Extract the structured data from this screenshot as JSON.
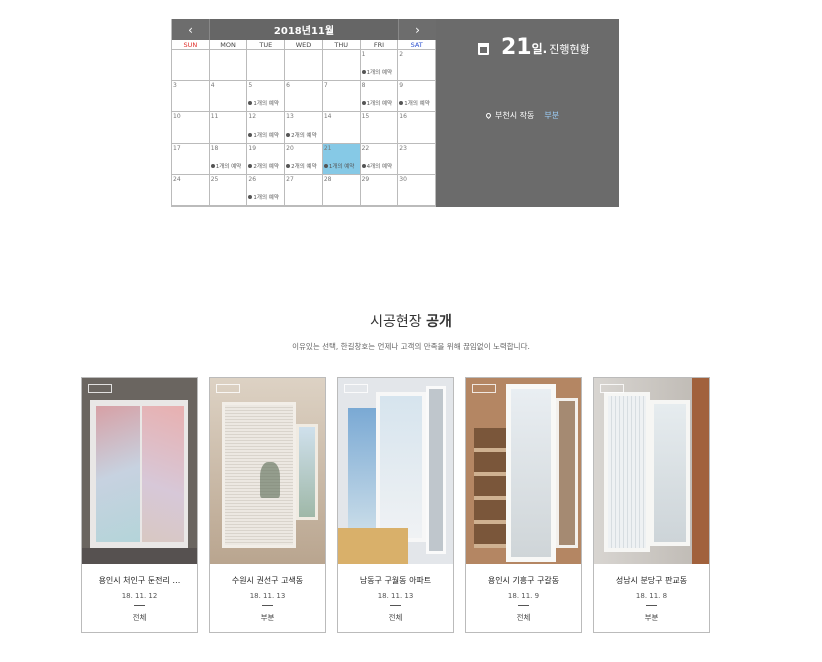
{
  "calendar": {
    "title": "2018년11월",
    "prev_label": "‹",
    "next_label": "›",
    "weekdays": [
      "SUN",
      "MON",
      "TUE",
      "WED",
      "THU",
      "FRI",
      "SAT"
    ],
    "weeks": [
      [
        {
          "d": "",
          "e": ""
        },
        {
          "d": "",
          "e": ""
        },
        {
          "d": "",
          "e": ""
        },
        {
          "d": "",
          "e": ""
        },
        {
          "d": "",
          "e": ""
        },
        {
          "d": "1",
          "e": "1개의 예약"
        },
        {
          "d": "2",
          "e": ""
        }
      ],
      [
        {
          "d": "3",
          "e": ""
        },
        {
          "d": "4",
          "e": ""
        },
        {
          "d": "5",
          "e": "1개의 예약"
        },
        {
          "d": "6",
          "e": ""
        },
        {
          "d": "7",
          "e": ""
        },
        {
          "d": "8",
          "e": "1개의 예약"
        },
        {
          "d": "9",
          "e": "1개의 예약"
        }
      ],
      [
        {
          "d": "10",
          "e": ""
        },
        {
          "d": "11",
          "e": ""
        },
        {
          "d": "12",
          "e": "1개의 예약"
        },
        {
          "d": "13",
          "e": "2개의 예약"
        },
        {
          "d": "14",
          "e": ""
        },
        {
          "d": "15",
          "e": ""
        },
        {
          "d": "16",
          "e": ""
        }
      ],
      [
        {
          "d": "17",
          "e": ""
        },
        {
          "d": "18",
          "e": "1개의 예약"
        },
        {
          "d": "19",
          "e": "2개의 예약"
        },
        {
          "d": "20",
          "e": "2개의 예약"
        },
        {
          "d": "21",
          "e": "1개의 예약",
          "today": true
        },
        {
          "d": "22",
          "e": "4개의 예약"
        },
        {
          "d": "23",
          "e": ""
        }
      ],
      [
        {
          "d": "24",
          "e": ""
        },
        {
          "d": "25",
          "e": ""
        },
        {
          "d": "26",
          "e": "1개의 예약"
        },
        {
          "d": "27",
          "e": ""
        },
        {
          "d": "28",
          "e": ""
        },
        {
          "d": "29",
          "e": ""
        },
        {
          "d": "30",
          "e": ""
        }
      ]
    ]
  },
  "status": {
    "day": "21",
    "day_unit": "일.",
    "label": "진행현황",
    "location": "부천시 작동",
    "tag": "부분",
    "icon": "calendar-icon",
    "pin_icon": "map-pin-icon"
  },
  "section": {
    "title_light": "시공현장",
    "title_bold": "공개",
    "subtitle": "이유있는 선택, 한길창호는 언제나 고객의 만족을 위해 끊임없이 노력합니다."
  },
  "cards": [
    {
      "title": "용인시 처인구 둔전리 …",
      "date": "18. 11. 12",
      "category": "전체"
    },
    {
      "title": "수원시 권선구 고색동",
      "date": "18. 11. 13",
      "category": "부분"
    },
    {
      "title": "남동구 구월동 아파트",
      "date": "18. 11. 13",
      "category": "전체"
    },
    {
      "title": "용인시 기흥구 구갈동",
      "date": "18. 11. 9",
      "category": "전체"
    },
    {
      "title": "성남시 분당구 판교동",
      "date": "18. 11. 8",
      "category": "부분"
    }
  ],
  "colors": {
    "status_bg": "#6b6b6b",
    "today_bg": "#86c9e6",
    "sunday": "#e0302b",
    "saturday": "#2b50d0",
    "tag": "#9fd3ff"
  }
}
